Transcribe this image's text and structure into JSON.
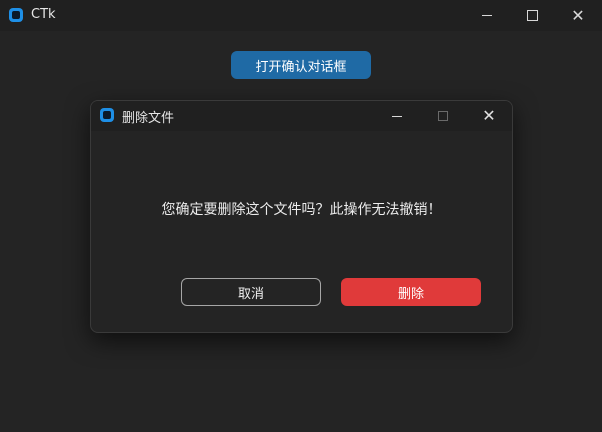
{
  "main_window": {
    "title": "CTk",
    "icon": "ctk-app-icon",
    "controls": {
      "minimize": "minimize-icon",
      "maximize": "maximize-icon",
      "close": "close-icon",
      "close_glyph": "✕"
    },
    "open_button_label": "打开确认对话框"
  },
  "dialog": {
    "title": "删除文件",
    "icon": "ctk-app-icon",
    "controls": {
      "minimize": "minimize-icon",
      "maximize": "maximize-icon",
      "close": "close-icon",
      "close_glyph": "✕"
    },
    "message": "您确定要删除这个文件吗？此操作无法撤销！",
    "cancel_label": "取消",
    "delete_label": "删除"
  },
  "colors": {
    "background": "#242424",
    "accent": "#1f6aa5",
    "danger": "#e03a3a",
    "icon": "#1e8fe6"
  }
}
